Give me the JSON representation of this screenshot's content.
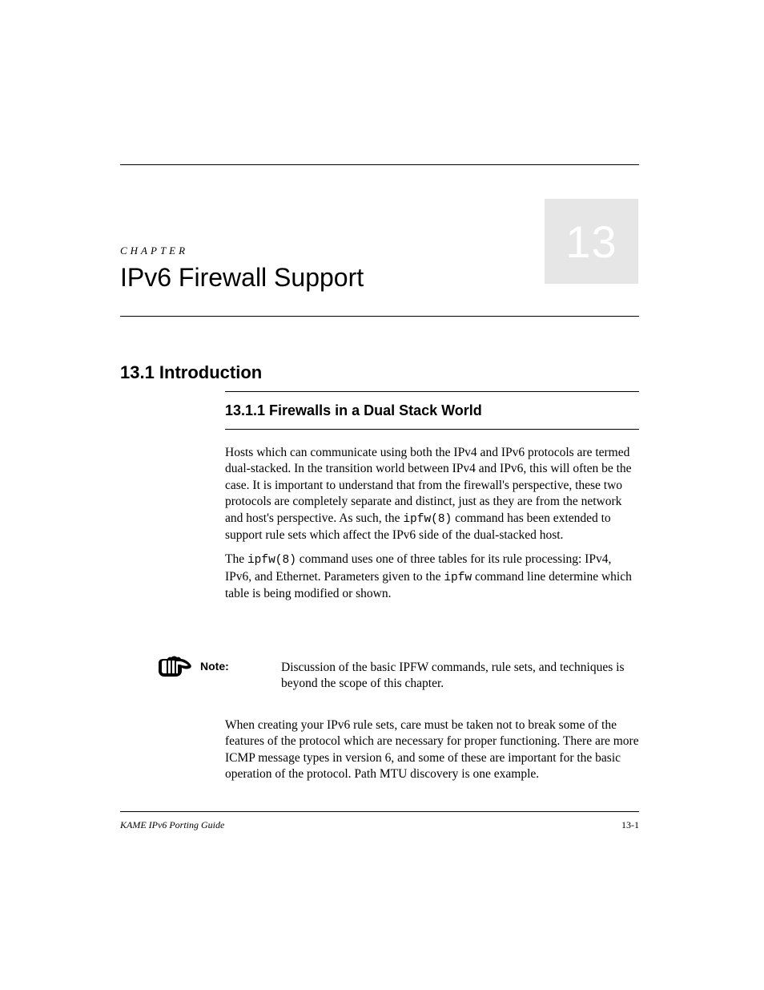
{
  "chapter": {
    "label": "CHAPTER",
    "number": "13",
    "title": "IPv6 Firewall Support"
  },
  "section": {
    "heading": "13.1 Introduction",
    "subheading": "13.1.1 Firewalls in a Dual Stack World"
  },
  "paragraphs": {
    "p1": "Hosts which can communicate using both the IPv4 and IPv6 protocols are termed dual-stacked. In the transition world between IPv4 and IPv6, this will often be the case. It is important to understand that from the firewall's perspective, these two protocols are completely separate and distinct, just as they are from the network and host's perspective. As such, the",
    "p1_code": "ipfw(8)",
    "p1_cont": " command has been extended to support rule sets which affect the IPv6 side of the dual-stacked host.",
    "p2_a": "The ",
    "p2_code1": "ipfw(8)",
    "p2_b": " command uses one of three tables for its rule processing: IPv4, IPv6, and Ethernet. Parameters given to the ",
    "p2_code2": "ipfw",
    "p2_c": " command line determine which table is being modified or shown."
  },
  "note": {
    "label": "Note:",
    "text": "Discussion of the basic IPFW commands, rule sets, and techniques is beyond the scope of this chapter."
  },
  "paragraphs2": {
    "p3": "When creating your IPv6 rule sets, care must be taken not to break some of the features of the protocol which are necessary for proper functioning. There are more ICMP message types in version 6, and some of these are important for the basic operation of the protocol. Path MTU discovery is one example."
  },
  "footer": {
    "left": "KAME IPv6 Porting Guide",
    "right": "13-1"
  }
}
